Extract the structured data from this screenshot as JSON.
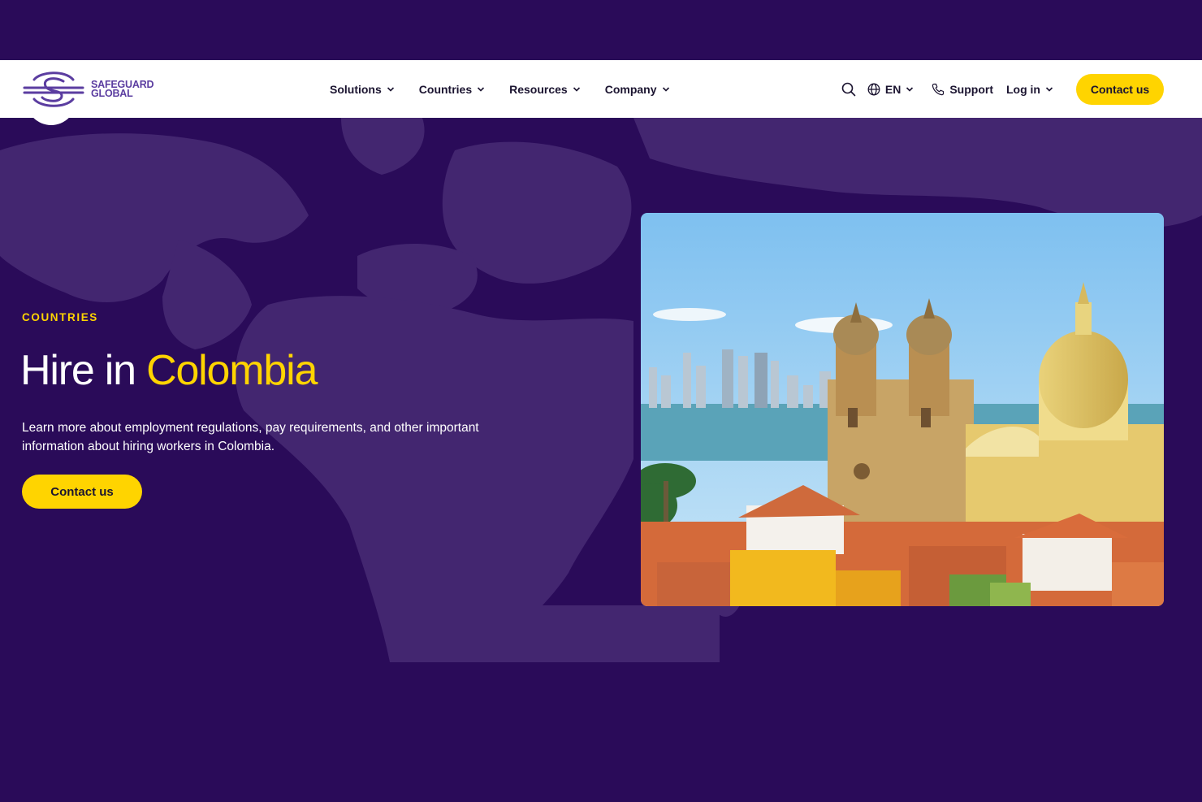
{
  "brand": {
    "line1": "SAFEGUARD",
    "line2": "GLOBAL",
    "color": "#5b3da0"
  },
  "nav": {
    "items": [
      {
        "label": "Solutions"
      },
      {
        "label": "Countries"
      },
      {
        "label": "Resources"
      },
      {
        "label": "Company"
      }
    ]
  },
  "utility": {
    "language": "EN",
    "support": "Support",
    "login": "Log in",
    "contact": "Contact us"
  },
  "hero": {
    "eyebrow": "COUNTRIES",
    "headline_prefix": "Hire in ",
    "headline_accent": "Colombia",
    "lead": "Learn more about employment regulations, pay requirements, and other important information about hiring workers in Colombia.",
    "cta": "Contact us"
  },
  "colors": {
    "background": "#2a0b59",
    "map": "#432670",
    "accent": "#ffd400",
    "header": "#ffffff"
  },
  "icons": [
    "search-icon",
    "globe-icon",
    "phone-icon",
    "chevron-down-icon"
  ]
}
